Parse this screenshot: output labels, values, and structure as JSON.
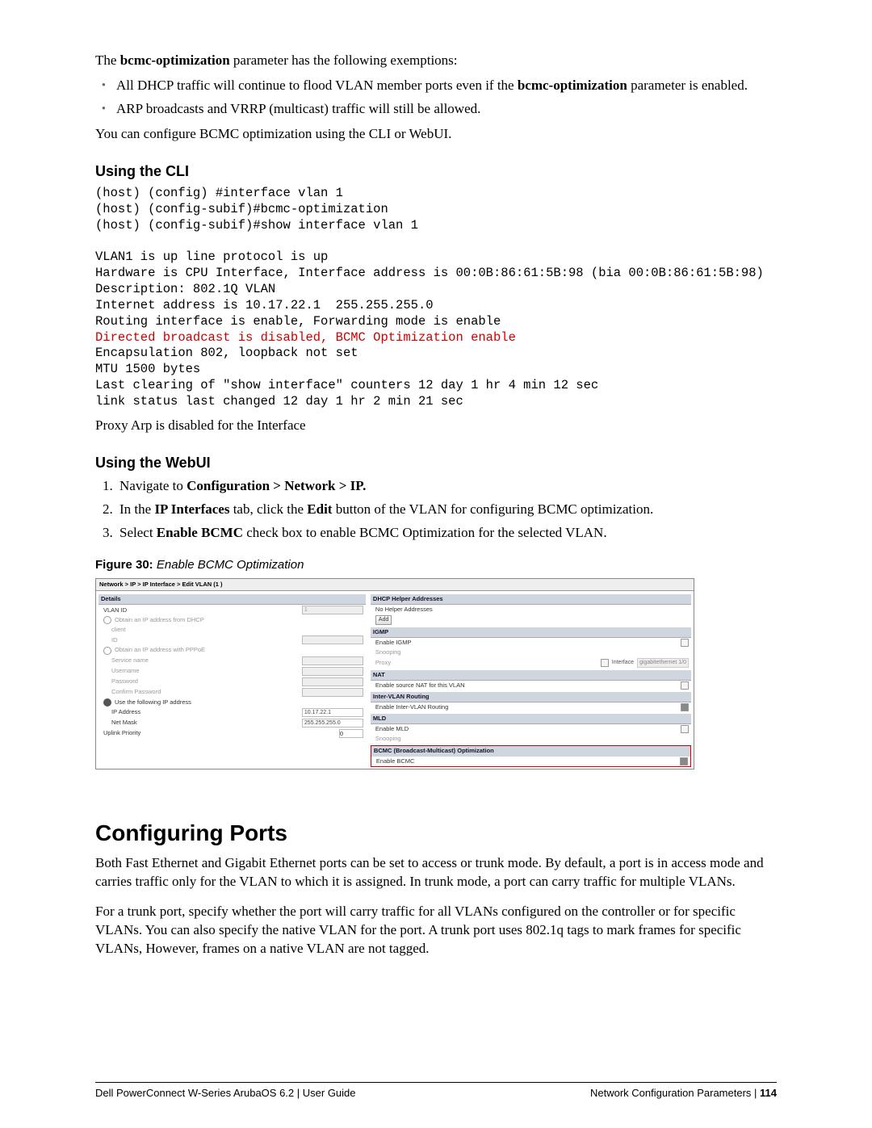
{
  "intro": {
    "p1_pre": "The ",
    "p1_bold": "bcmc-optimization",
    "p1_post": " parameter has the following exemptions:",
    "bullet1_pre": "All DHCP traffic will continue to flood VLAN member ports even if the ",
    "bullet1_bold": "bcmc-optimization",
    "bullet1_post": " parameter is enabled.",
    "bullet2": "ARP broadcasts and VRRP (multicast) traffic will still be allowed.",
    "p2": "You can configure BCMC optimization using the CLI or WebUI."
  },
  "cli": {
    "heading": "Using the CLI",
    "block_pre": "(host) (config) #interface vlan 1\n(host) (config-subif)#bcmc-optimization\n(host) (config-subif)#show interface vlan 1\n\nVLAN1 is up line protocol is up\nHardware is CPU Interface, Interface address is 00:0B:86:61:5B:98 (bia 00:0B:86:61:5B:98)\nDescription: 802.1Q VLAN\nInternet address is 10.17.22.1  255.255.255.0\nRouting interface is enable, Forwarding mode is enable\n",
    "block_red": "Directed broadcast is disabled, BCMC Optimization enable\n",
    "block_post": "Encapsulation 802, loopback not set\nMTU 1500 bytes\nLast clearing of \"show interface\" counters 12 day 1 hr 4 min 12 sec\nlink status last changed 12 day 1 hr 2 min 21 sec",
    "p_after": "Proxy Arp is disabled for the Interface"
  },
  "webui": {
    "heading": "Using the WebUI",
    "steps": [
      {
        "pre": "Navigate to ",
        "bold": "Configuration > Network > IP.",
        "post": ""
      },
      {
        "pre": "In the ",
        "bold": "IP Interfaces",
        "mid": " tab, click the ",
        "bold2": "Edit",
        "post": " button of the VLAN for configuring BCMC optimization."
      },
      {
        "pre": "Select ",
        "bold": "Enable BCMC",
        "post": " check box to enable BCMC Optimization for the selected VLAN."
      }
    ],
    "figcap_label": "Figure 30:",
    "figcap_title": " Enable BCMC Optimization",
    "crumb": "Network > IP > IP Interface > Edit VLAN (1 )",
    "left": {
      "details": "Details",
      "vlan_id": "VLAN ID",
      "vlan_id_val": "1",
      "obtain_dhcp": "Obtain an IP address from DHCP",
      "client": "client",
      "id_lbl": "ID",
      "obtain_pppoe": "Obtain an IP address with PPPoE",
      "svc": "Service name",
      "user": "Username",
      "pwd": "Password",
      "conf_pwd": "Confirm Password",
      "use_following": "Use the following IP address",
      "ip": "IP Address",
      "ip_val": "10.17.22.1",
      "mask": "Net Mask",
      "mask_val": "255.255.255.0",
      "uplink": "Uplink Priority",
      "uplink_val": "0"
    },
    "right": {
      "helper": "DHCP Helper Addresses",
      "no_helper": "No Helper Addresses",
      "add": "Add",
      "igmp": "IGMP",
      "enable_igmp": "Enable IGMP",
      "snooping": "Snooping",
      "proxy": "Proxy",
      "iface": "Interface",
      "iface_val": "gigabitethernet 1/0",
      "nat": "NAT",
      "enable_nat": "Enable source NAT for this VLAN",
      "intervlan": "Inter-VLAN Routing",
      "enable_ivr": "Enable Inter-VLAN Routing",
      "mld": "MLD",
      "enable_mld": "Enable MLD",
      "mld_snoop": "Snooping",
      "bcmc_hdr": "BCMC (Broadcast-Multicast) Optimization",
      "enable_bcmc": "Enable BCMC"
    }
  },
  "ports": {
    "heading": "Configuring Ports",
    "p1": "Both Fast Ethernet and Gigabit Ethernet ports can be set to access or trunk mode. By default, a port is in access mode and carries traffic only for the VLAN to which it is assigned. In trunk mode, a port can carry traffic for multiple VLANs.",
    "p2": "For a trunk port, specify whether the port will carry traffic for all VLANs configured on the controller or for specific VLANs. You can also specify the native VLAN for the port. A trunk port uses 802.1q tags to mark frames for specific VLANs, However, frames on a native VLAN are not tagged."
  },
  "footer": {
    "left": "Dell PowerConnect W-Series ArubaOS 6.2",
    "left_sep": "  |  User Guide",
    "right_lbl": "Network Configuration Parameters  |  ",
    "right_page": "114"
  }
}
